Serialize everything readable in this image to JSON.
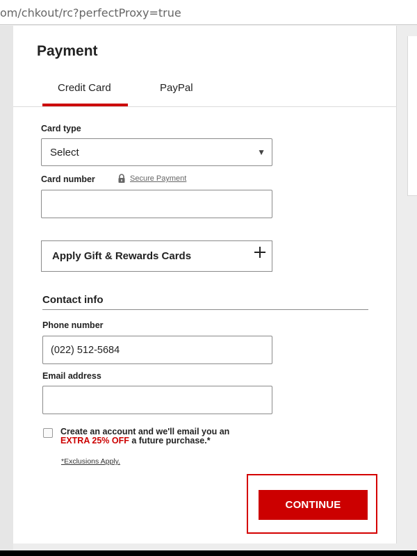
{
  "browser": {
    "url": "om/chkout/rc?perfectProxy=true"
  },
  "payment": {
    "title": "Payment",
    "tabs": [
      {
        "label": "Credit Card",
        "active": true
      },
      {
        "label": "PayPal",
        "active": false
      }
    ],
    "card_type": {
      "label": "Card type",
      "selected": "Select"
    },
    "card_number": {
      "label": "Card number",
      "secure_link": "Secure Payment",
      "value": ""
    },
    "gift_cards_label": "Apply Gift & Rewards Cards"
  },
  "contact": {
    "heading": "Contact info",
    "phone": {
      "label": "Phone number",
      "value": "(022) 512-5684"
    },
    "email": {
      "label": "Email address",
      "value": ""
    }
  },
  "account_offer": {
    "text_before": "Create an account and we'll email you an",
    "highlight": "EXTRA 25% OFF",
    "text_after": "a future purchase.*",
    "checked": false,
    "exclusions_link": "*Exclusions Apply."
  },
  "continue_label": "CONTINUE",
  "colors": {
    "accent_red": "#cc0000",
    "highlight_border": "#d40000"
  }
}
